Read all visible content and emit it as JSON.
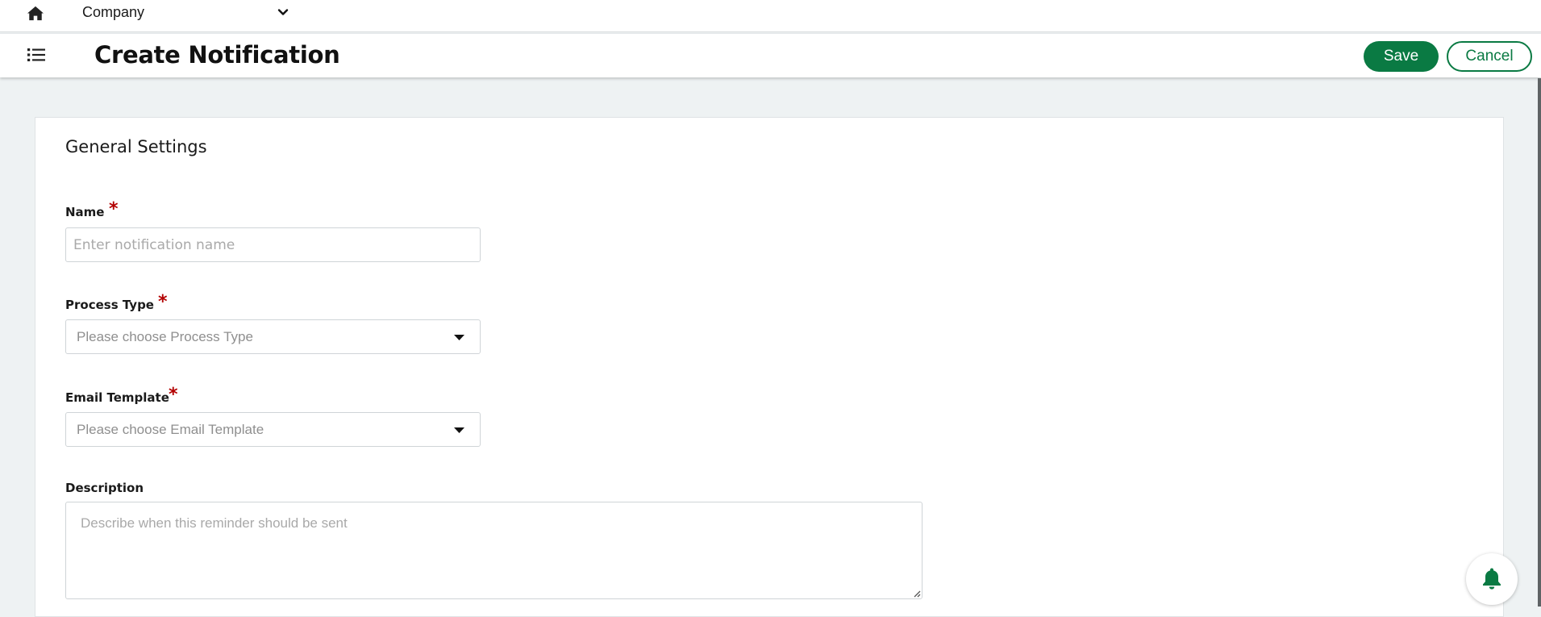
{
  "topbar": {
    "home_icon": "home-icon",
    "company_select": {
      "value": "Company",
      "icon": "chevron-down-icon"
    }
  },
  "header": {
    "menu_icon": "list-icon",
    "title": "Create Notification",
    "save_label": "Save",
    "cancel_label": "Cancel"
  },
  "form": {
    "section_title": "General Settings",
    "required_marker": "*",
    "name": {
      "label": "Name",
      "required": true,
      "value": "",
      "placeholder": "Enter notification name"
    },
    "process_type": {
      "label": "Process Type",
      "required": true,
      "placeholder": "Please choose Process Type",
      "icon": "caret-down-icon"
    },
    "email_template": {
      "label": "Email Template",
      "required": true,
      "placeholder": "Please choose Email Template",
      "icon": "caret-down-icon"
    },
    "description": {
      "label": "Description",
      "value": "",
      "placeholder": "Describe when this reminder should be sent"
    }
  },
  "notifications_fab": {
    "icon": "bell-icon"
  },
  "colors": {
    "accent": "#0a7a43",
    "required": "#b30000",
    "page_background": "#eef2f3"
  }
}
